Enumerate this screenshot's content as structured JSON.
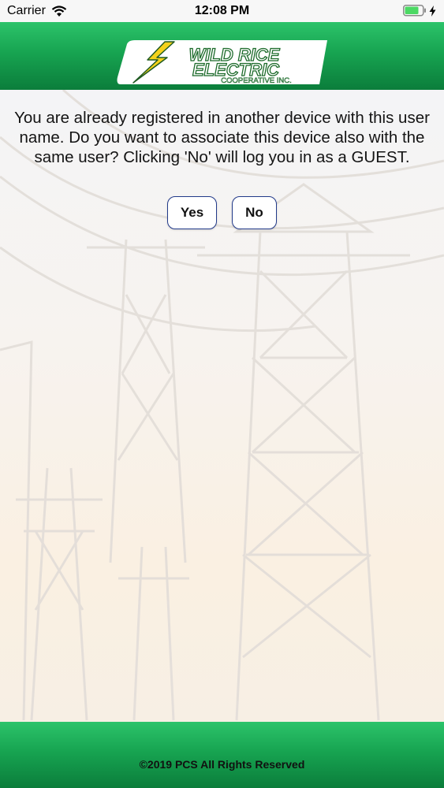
{
  "status_bar": {
    "carrier": "Carrier",
    "time": "12:08 PM",
    "wifi_icon": "wifi-icon",
    "battery_icon": "battery-icon",
    "charging_icon": "charging-bolt-icon"
  },
  "header": {
    "logo": {
      "line1": "WILD RICE",
      "line2": "ELECTRIC",
      "line3": "COOPERATIVE INC.",
      "icon": "lightning-bolt-icon"
    }
  },
  "dialog": {
    "message": "You are already registered in another device with this user name. Do you want to associate this device also with the same user? Clicking 'No' will log you in as a GUEST.",
    "yes_label": "Yes",
    "no_label": "No"
  },
  "footer": {
    "copyright": "©2019 PCS All Rights Reserved"
  },
  "colors": {
    "header_green": "#17a451",
    "footer_green": "#17a451",
    "button_border": "#223a8a",
    "logo_green": "#1f7a2e",
    "bolt_yellow": "#f5d21a"
  }
}
